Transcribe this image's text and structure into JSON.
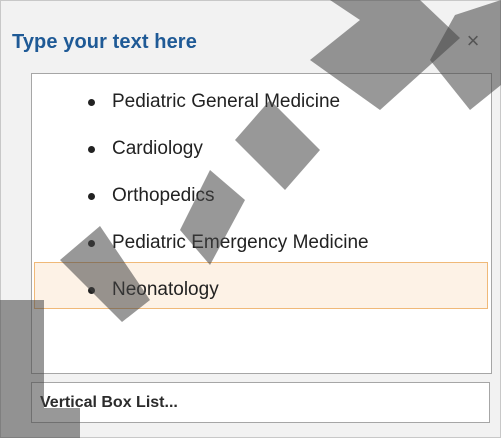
{
  "pane": {
    "title": "Type your text here",
    "close_symbol": "×"
  },
  "list": {
    "items": [
      {
        "label": "Pediatric General Medicine"
      },
      {
        "label": "Cardiology"
      },
      {
        "label": "Orthopedics"
      },
      {
        "label": "Pediatric Emergency Medicine"
      },
      {
        "label": "Neonatology",
        "selected": true
      }
    ]
  },
  "footer": {
    "link_label": "Vertical Box List..."
  },
  "colors": {
    "title": "#1f5a96",
    "selection_fill": "#fdf2e6",
    "selection_border": "#f0b978",
    "pane_background": "#f2f2f2",
    "watermark": "#000000"
  }
}
